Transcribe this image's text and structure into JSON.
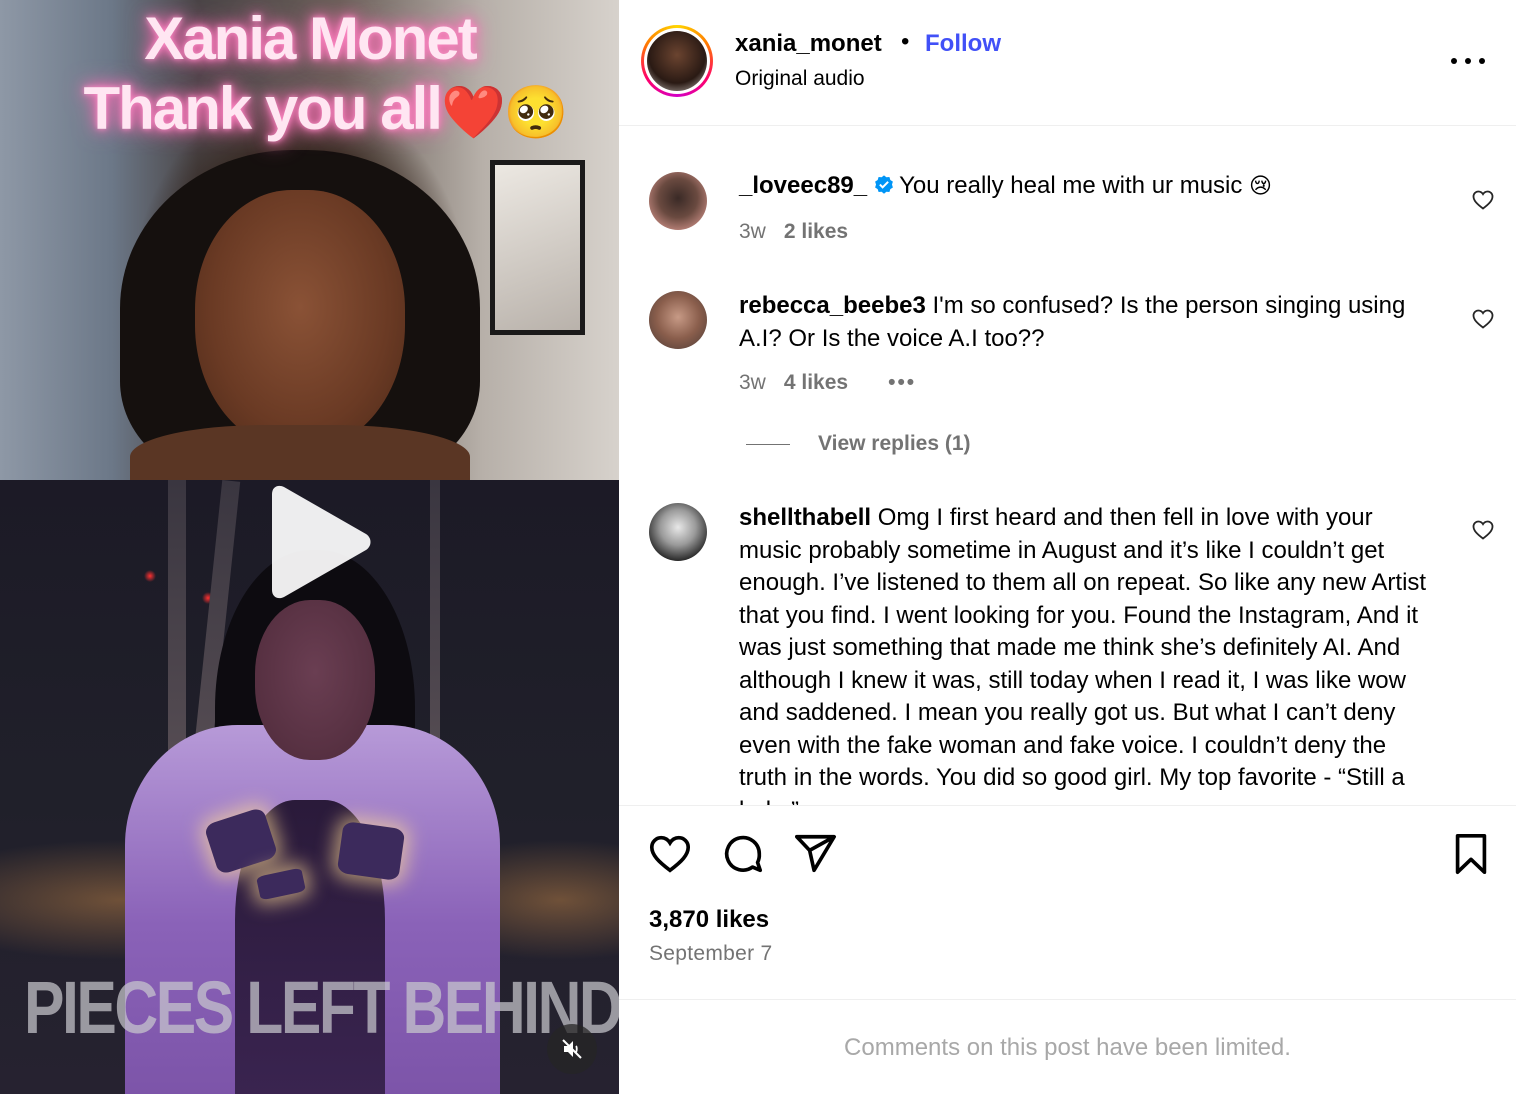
{
  "media": {
    "overlay_line1": "Xania Monet",
    "overlay_line2": "Thank you all",
    "overlay_emojis": "❤️🥺",
    "bottom_text": "PIECES LEFT BEHIND,",
    "play_icon": "play-icon",
    "mute_icon": "speaker-muted-icon"
  },
  "post": {
    "username": "xania_monet",
    "separator": "•",
    "follow_label": "Follow",
    "audio_label": "Original audio",
    "likes": "3,870 likes",
    "date": "September 7",
    "comments_limited": "Comments on this post have been limited."
  },
  "comments": [
    {
      "handle": "_loveec89_",
      "verified": true,
      "text": "You really heal me with ur music",
      "emoji": "😢",
      "age": "3w",
      "likes": "2 likes"
    },
    {
      "handle": "rebecca_beebe3",
      "text": "I'm so confused? Is the person singing using A.I? Or Is the voice A.I too??",
      "age": "3w",
      "likes": "4 likes",
      "options": "•••",
      "view_replies": "View replies (1)"
    },
    {
      "handle": "shellthabell",
      "text": "Omg I first heard and then fell in love with your music probably sometime in August and it’s like I couldn’t get enough. I’ve listened to them all on repeat. So like any new Artist that you find. I went looking for you. Found the Instagram, And it was just something that made me think she’s definitely AI. And although I knew it was, still today when I read it, I was like wow and saddened. I mean you really got us. But what I can’t deny even with the fake woman and fake voice. I couldn’t deny the truth in the words. You did so good girl. My top favorite - “Still a baby”"
    }
  ],
  "colors": {
    "follow_blue": "#4150f7",
    "meta_gray": "#737373",
    "verified_blue": "#0095f6"
  }
}
